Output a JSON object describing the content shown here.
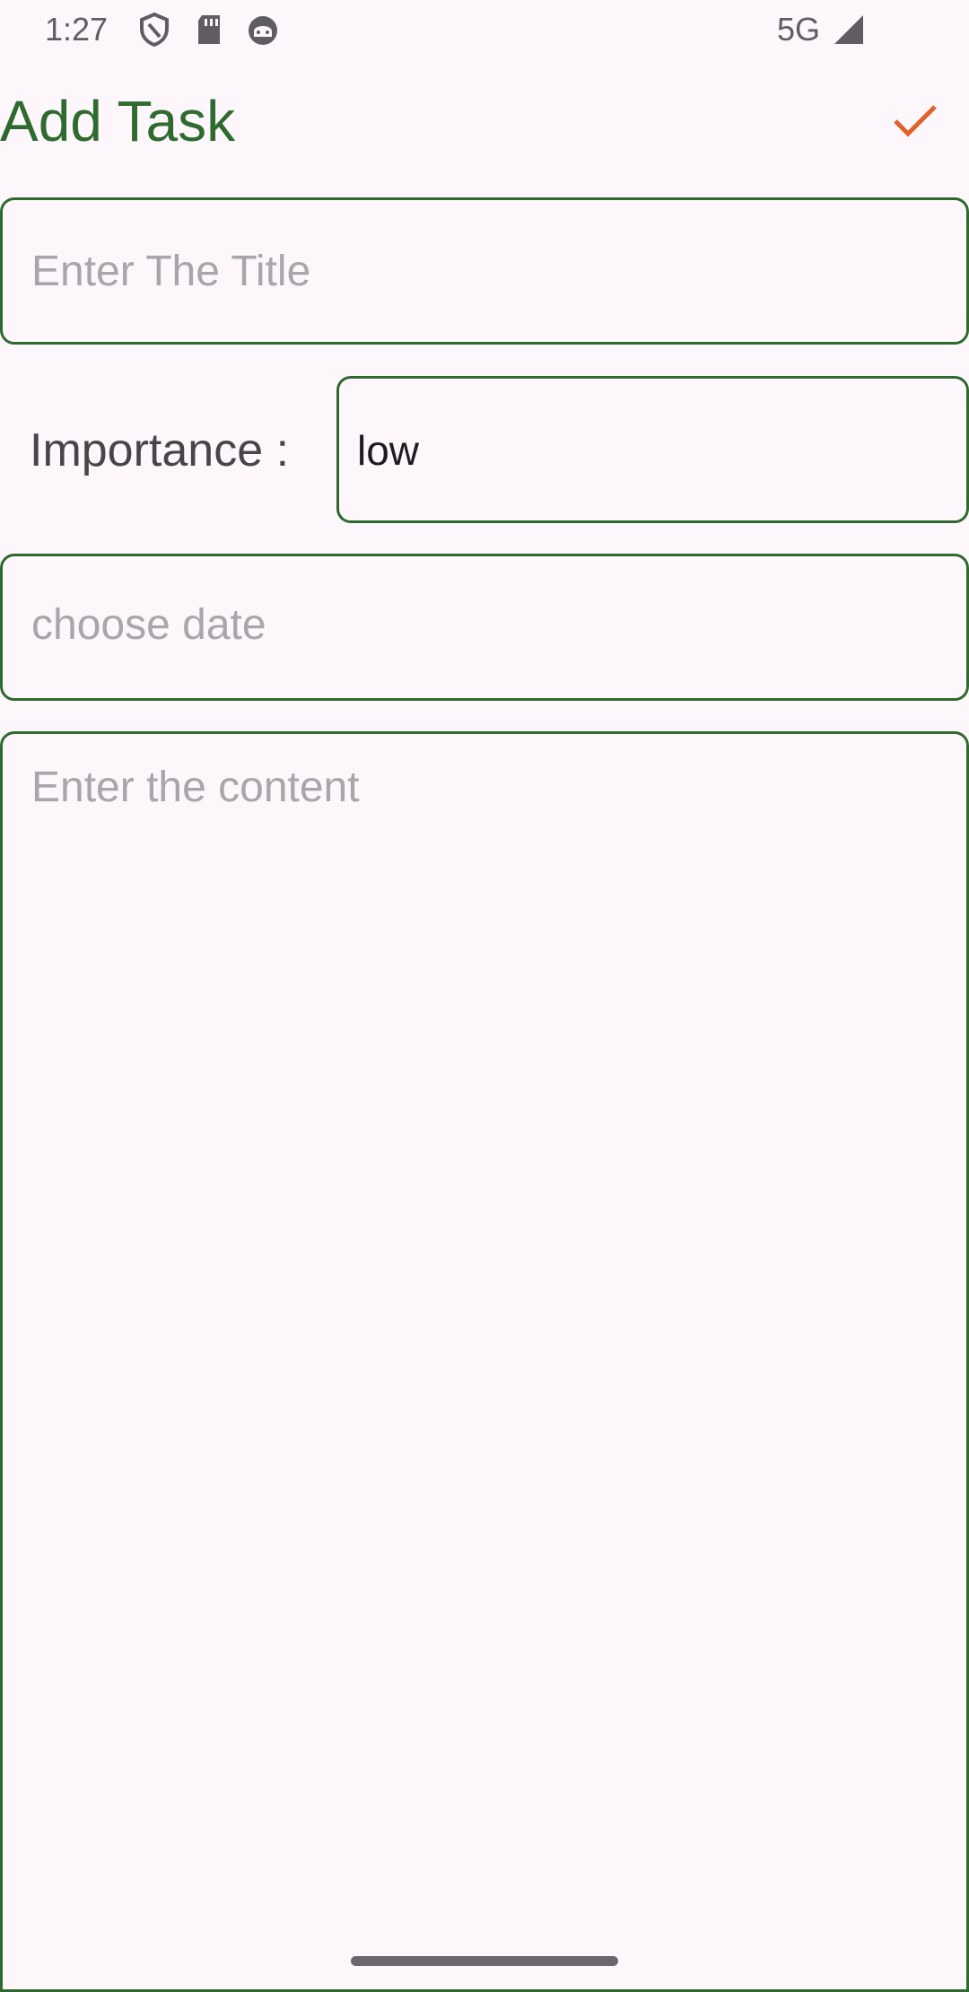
{
  "status_bar": {
    "time": "1:27",
    "network": "5G",
    "icons": [
      "shield-icon",
      "sd-card-icon",
      "android-debug-icon",
      "signal-icon"
    ]
  },
  "header": {
    "title": "Add Task",
    "confirm_icon": "checkmark-icon"
  },
  "form": {
    "title_placeholder": "Enter The Title",
    "importance_label": "Importance :",
    "importance_value": "low",
    "date_placeholder": "choose date",
    "content_placeholder": "Enter the content"
  },
  "colors": {
    "background": "#fdf7fc",
    "accent_green": "#2f6b2f",
    "confirm_orange": "#e0622a",
    "placeholder_gray": "#a8a6aa"
  }
}
